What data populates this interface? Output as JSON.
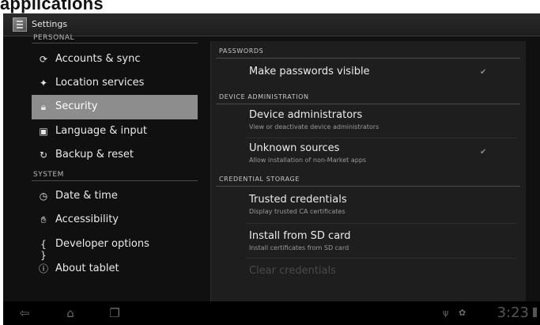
{
  "document": {
    "heading": "applications"
  },
  "app": {
    "title": "Settings"
  },
  "sidebar": {
    "personal_header": "PERSONAL",
    "system_header": "SYSTEM",
    "personal_items": [
      {
        "label": "Accounts & sync",
        "icon": "sync-icon"
      },
      {
        "label": "Location services",
        "icon": "location-icon"
      },
      {
        "label": "Security",
        "icon": "lock-icon",
        "selected": true
      },
      {
        "label": "Language & input",
        "icon": "keyboard-icon"
      },
      {
        "label": "Backup & reset",
        "icon": "backup-icon"
      }
    ],
    "system_items": [
      {
        "label": "Date & time",
        "icon": "clock-icon"
      },
      {
        "label": "Accessibility",
        "icon": "hand-icon"
      },
      {
        "label": "Developer options",
        "icon": "braces-icon"
      },
      {
        "label": "About tablet",
        "icon": "info-icon"
      }
    ]
  },
  "panel": {
    "categories": {
      "passwords": "PASSWORDS",
      "device_admin": "DEVICE ADMINISTRATION",
      "credential_storage": "CREDENTIAL STORAGE"
    },
    "prefs": {
      "make_passwords_visible": {
        "title": "Make passwords visible",
        "checked": true
      },
      "device_administrators": {
        "title": "Device administrators",
        "summary": "View or deactivate device administrators"
      },
      "unknown_sources": {
        "title": "Unknown sources",
        "summary": "Allow installation of non-Market apps",
        "checked": true
      },
      "trusted_credentials": {
        "title": "Trusted credentials",
        "summary": "Display trusted CA certificates"
      },
      "install_from_sd": {
        "title": "Install from SD card",
        "summary": "Install certificates from SD card"
      },
      "clear_credentials": {
        "title": "Clear credentials"
      }
    },
    "check_glyph": "✔"
  },
  "navbar": {
    "back_icon": "back-icon",
    "home_icon": "home-icon",
    "recents_icon": "recent-apps-icon",
    "clock": "3:23"
  }
}
